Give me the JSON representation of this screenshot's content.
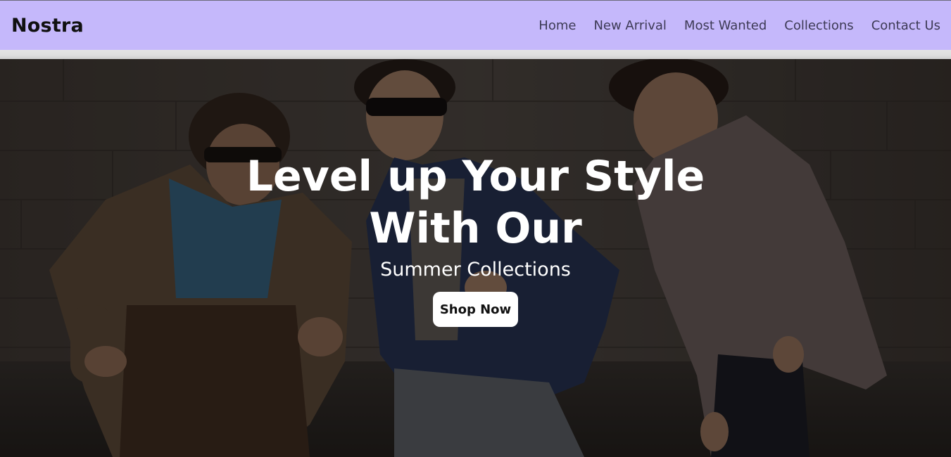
{
  "navbar": {
    "brand": "Nostra",
    "links": [
      {
        "label": "Home"
      },
      {
        "label": "New Arrival"
      },
      {
        "label": "Most Wanted"
      },
      {
        "label": "Collections"
      },
      {
        "label": "Contact Us"
      }
    ]
  },
  "hero": {
    "title_line1": "Level up Your Style",
    "title_line2": "With Our",
    "subtitle": "Summer Collections",
    "button_label": "Shop Now",
    "background_image": "three-men-in-suits-street-photo"
  },
  "colors": {
    "navbar_bg": "#c5b8fb",
    "hero_overlay": "#000000",
    "button_bg": "#ffffff",
    "hero_text": "#ffffff"
  }
}
